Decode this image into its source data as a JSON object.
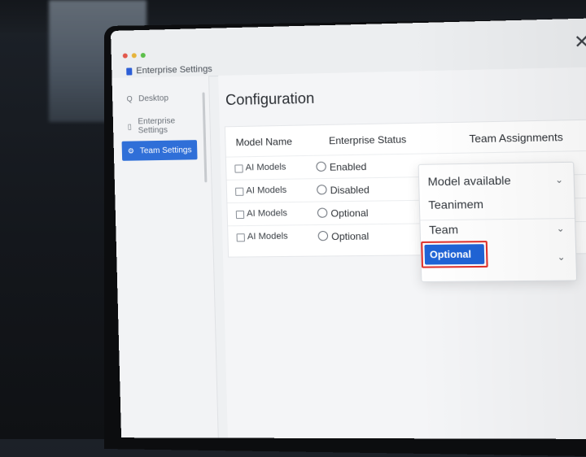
{
  "window": {
    "title": "Enterprise Settings",
    "close_glyph": "✕"
  },
  "sidebar": {
    "items": [
      {
        "icon": "search-icon",
        "glyph": "Q",
        "label": "Desktop",
        "active": false
      },
      {
        "icon": "document-icon",
        "glyph": "▯",
        "label": "Enterprise Settings",
        "active": false
      },
      {
        "icon": "gear-icon",
        "glyph": "⚙",
        "label": "Team Settings",
        "active": true
      }
    ]
  },
  "main": {
    "title": "Configuration",
    "table": {
      "headers": [
        "Model Name",
        "Enterprise Status",
        "Team Assignments"
      ],
      "rows": [
        {
          "model": "AI Models",
          "status": "Enabled"
        },
        {
          "model": "AI Models",
          "status": "Disabled"
        },
        {
          "model": "AI Models",
          "status": "Optional"
        },
        {
          "model": "AI Models",
          "status": "Optional"
        }
      ]
    },
    "dropdown": {
      "items": [
        "Model available",
        "Teanimem",
        "Team"
      ],
      "selected": "Optional"
    }
  },
  "colors": {
    "accent": "#1f64d6",
    "highlight_border": "#e0322c"
  }
}
